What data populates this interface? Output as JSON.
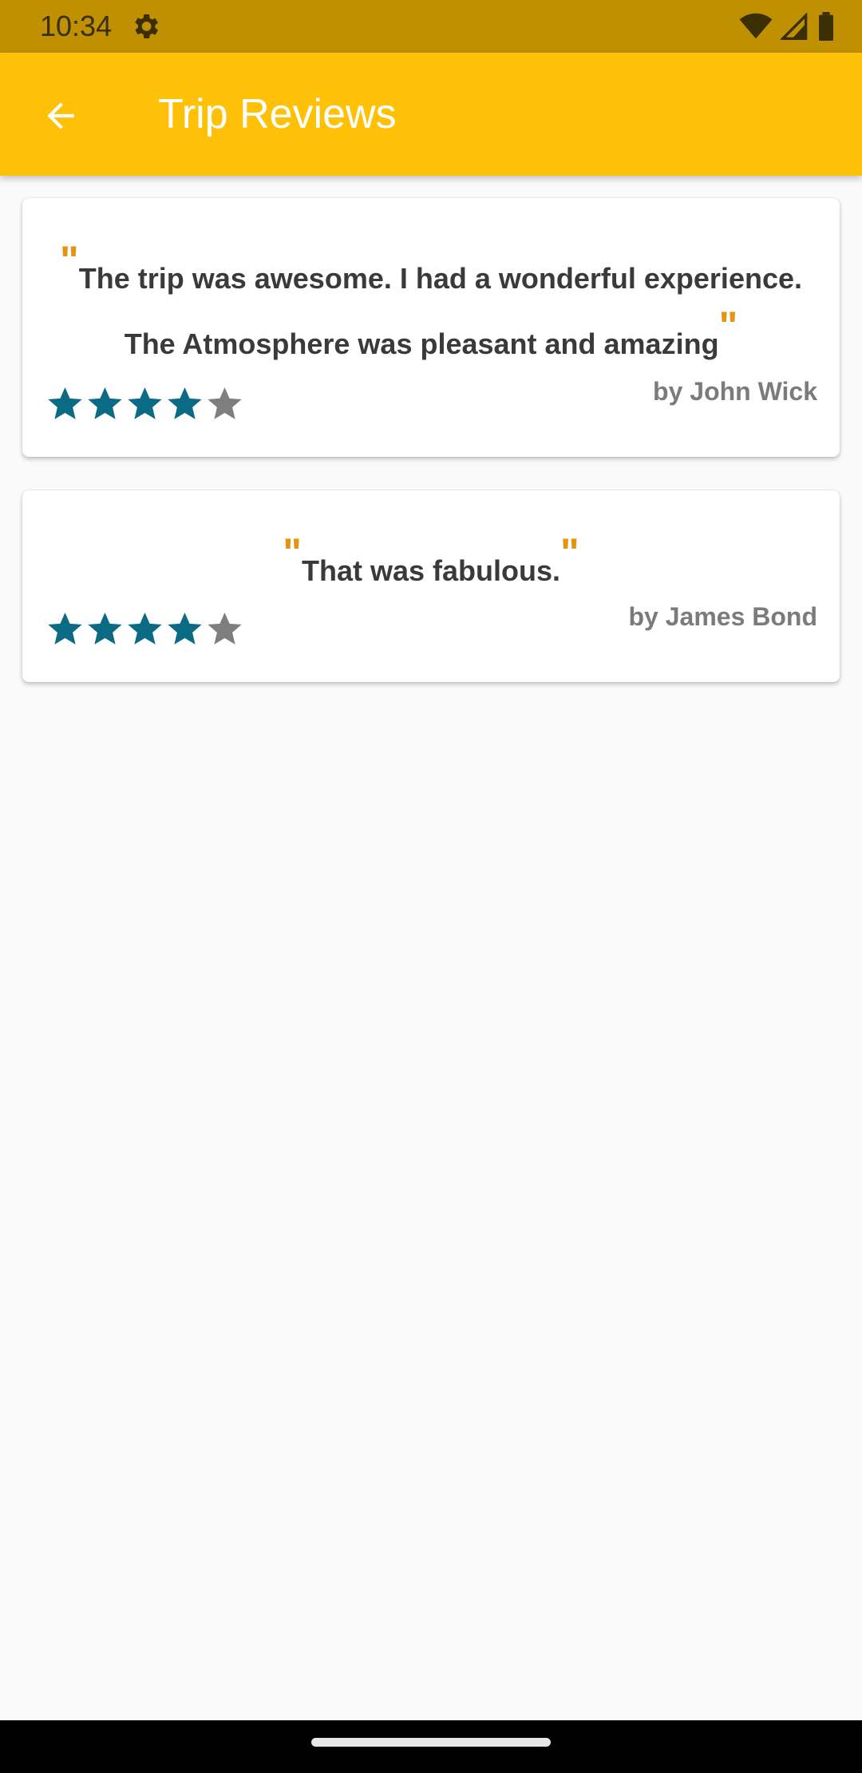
{
  "status_bar": {
    "time": "10:34",
    "icons": [
      "settings-gear-icon",
      "wifi-icon",
      "signal-icon",
      "battery-icon"
    ]
  },
  "app_bar": {
    "back_icon": "arrow-back-icon",
    "title": "Trip Reviews"
  },
  "reviews": [
    {
      "lines": [
        "The trip was awesome. I had a wonderful experience.",
        "The Atmosphere was pleasant and amazing"
      ],
      "rating": 4,
      "max_rating": 5,
      "author": "by John Wick"
    },
    {
      "lines": [
        "That  was fabulous."
      ],
      "rating": 4,
      "max_rating": 5,
      "author": "by James Bond"
    }
  ],
  "colors": {
    "status_bar": "#bf9002",
    "app_bar": "#ffc107",
    "quote_mark": "#e59411",
    "star_filled": "#0b6a84",
    "star_empty": "#7e7e7e",
    "review_text": "#3a3a3a",
    "author_text": "#7b7b7b"
  }
}
